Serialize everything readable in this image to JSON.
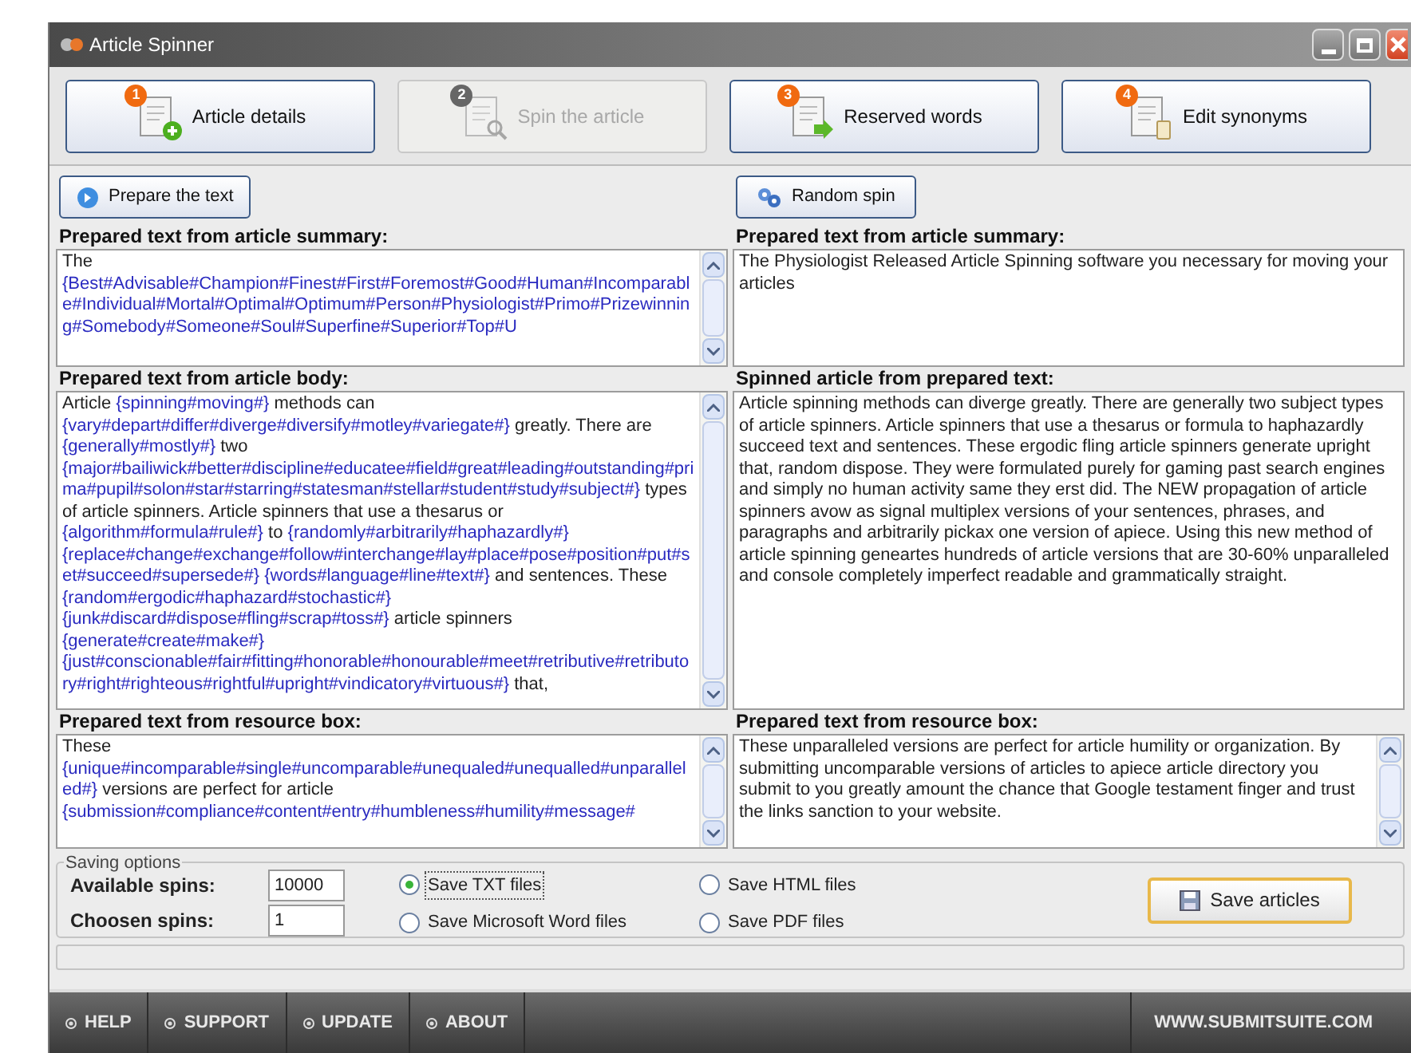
{
  "window": {
    "title": "Article Spinner"
  },
  "steps": [
    {
      "number": "1",
      "label": "Article details",
      "disabled": false,
      "kind": "add"
    },
    {
      "number": "2",
      "label": "Spin the article",
      "disabled": true,
      "kind": "search"
    },
    {
      "number": "3",
      "label": "Reserved words",
      "disabled": false,
      "kind": "arrow"
    },
    {
      "number": "4",
      "label": "Edit synonyms",
      "disabled": false,
      "kind": "clip"
    }
  ],
  "left": {
    "button": "Prepare the text",
    "panels": [
      {
        "heading": "Prepared text from article summary:",
        "segments": [
          {
            "kind": "plain",
            "text": "The "
          },
          {
            "kind": "token",
            "text": "{Best#Advisable#Champion#Finest#First#Foremost#Good#Human#Incomparable#Individual#Mortal#Optimal#Optimum#Person#Physiologist#Primo#Prizewinning#Somebody#Someone#Soul#Superfine#Superior#Top#U"
          }
        ]
      },
      {
        "heading": "Prepared text from article body:",
        "segments": [
          {
            "kind": "plain",
            "text": "Article "
          },
          {
            "kind": "token",
            "text": "{spinning#moving#}"
          },
          {
            "kind": "plain",
            "text": " methods can "
          },
          {
            "kind": "token",
            "text": "{vary#depart#differ#diverge#diversify#motley#variegate#}"
          },
          {
            "kind": "plain",
            "text": " greatly. There are "
          },
          {
            "kind": "token",
            "text": "{generally#mostly#}"
          },
          {
            "kind": "plain",
            "text": " two "
          },
          {
            "kind": "token",
            "text": "{major#bailiwick#better#discipline#educatee#field#great#leading#outstanding#prima#pupil#solon#star#starring#statesman#stellar#student#study#subject#}"
          },
          {
            "kind": "plain",
            "text": " types of article spinners. Article spinners that use a thesarus or "
          },
          {
            "kind": "token",
            "text": "{algorithm#formula#rule#}"
          },
          {
            "kind": "plain",
            "text": " to "
          },
          {
            "kind": "token",
            "text": "{randomly#arbitrarily#haphazardly#} "
          },
          {
            "kind": "token",
            "text": "{replace#change#exchange#follow#interchange#lay#place#pose#position#put#set#succeed#supersede#} "
          },
          {
            "kind": "token",
            "text": "{words#language#line#text#}"
          },
          {
            "kind": "plain",
            "text": " and sentences. These "
          },
          {
            "kind": "token",
            "text": "{random#ergodic#haphazard#stochastic#} "
          },
          {
            "kind": "token",
            "text": "{junk#discard#dispose#fling#scrap#toss#}"
          },
          {
            "kind": "plain",
            "text": " article spinners "
          },
          {
            "kind": "token",
            "text": "{generate#create#make#} "
          },
          {
            "kind": "token",
            "text": "{just#conscionable#fair#fitting#honorable#honourable#meet#retributive#retributory#right#righteous#rightful#upright#vindicatory#virtuous#}"
          },
          {
            "kind": "plain",
            "text": " that,"
          }
        ]
      },
      {
        "heading": "Prepared text from resource box:",
        "segments": [
          {
            "kind": "plain",
            "text": "These "
          },
          {
            "kind": "token",
            "text": "{unique#incomparable#single#uncomparable#unequaled#unequalled#unparalleled#}"
          },
          {
            "kind": "plain",
            "text": " versions are perfect for article "
          },
          {
            "kind": "token",
            "text": "{submission#compliance#content#entry#humbleness#humility#message#"
          }
        ]
      }
    ]
  },
  "right": {
    "button": "Random spin",
    "panels": [
      {
        "heading": "Prepared text from article summary:",
        "text": "The Physiologist Released Article Spinning software you necessary for moving your articles",
        "scrollable": false
      },
      {
        "heading": "Spinned article from prepared text:",
        "text": "Article spinning methods can diverge greatly. There are generally two subject types of article spinners. Article spinners that use a thesarus or formula to haphazardly succeed text and sentences. These ergodic fling article spinners generate upright that, random dispose. They were formulated purely for gaming past search engines and simply no human activity same they erst did. The NEW propagation of article spinners avow as signal multiplex versions of your sentences, phrases, and paragraphs and arbitrarily pickax one version of apiece. Using this new method of article spinning geneartes hundreds of article versions that are 30-60% unparalleled and console completely imperfect readable and grammatically straight.",
        "scrollable": false
      },
      {
        "heading": "Prepared text from resource box:",
        "text": "These unparalleled versions are perfect for article humility or organization. By submitting uncomparable versions of articles to apiece article directory you submit to you greatly amount the chance that Google testament finger and trust the links sanction to your website.",
        "scrollable": true
      }
    ]
  },
  "saving_options": {
    "legend": "Saving options",
    "fields": [
      {
        "label": "Available spins:",
        "value": "10000"
      },
      {
        "label": "Choosen spins:",
        "value": "1"
      }
    ],
    "formats": [
      {
        "label": "Save TXT files",
        "selected": true
      },
      {
        "label": "Save HTML files",
        "selected": false
      },
      {
        "label": "Save Microsoft Word files",
        "selected": false
      },
      {
        "label": "Save PDF files",
        "selected": false
      }
    ],
    "save_button": "Save articles"
  },
  "footer": {
    "links": [
      "HELP",
      "SUPPORT",
      "UPDATE",
      "ABOUT"
    ],
    "site": "WWW.SUBMITSUITE.COM"
  }
}
